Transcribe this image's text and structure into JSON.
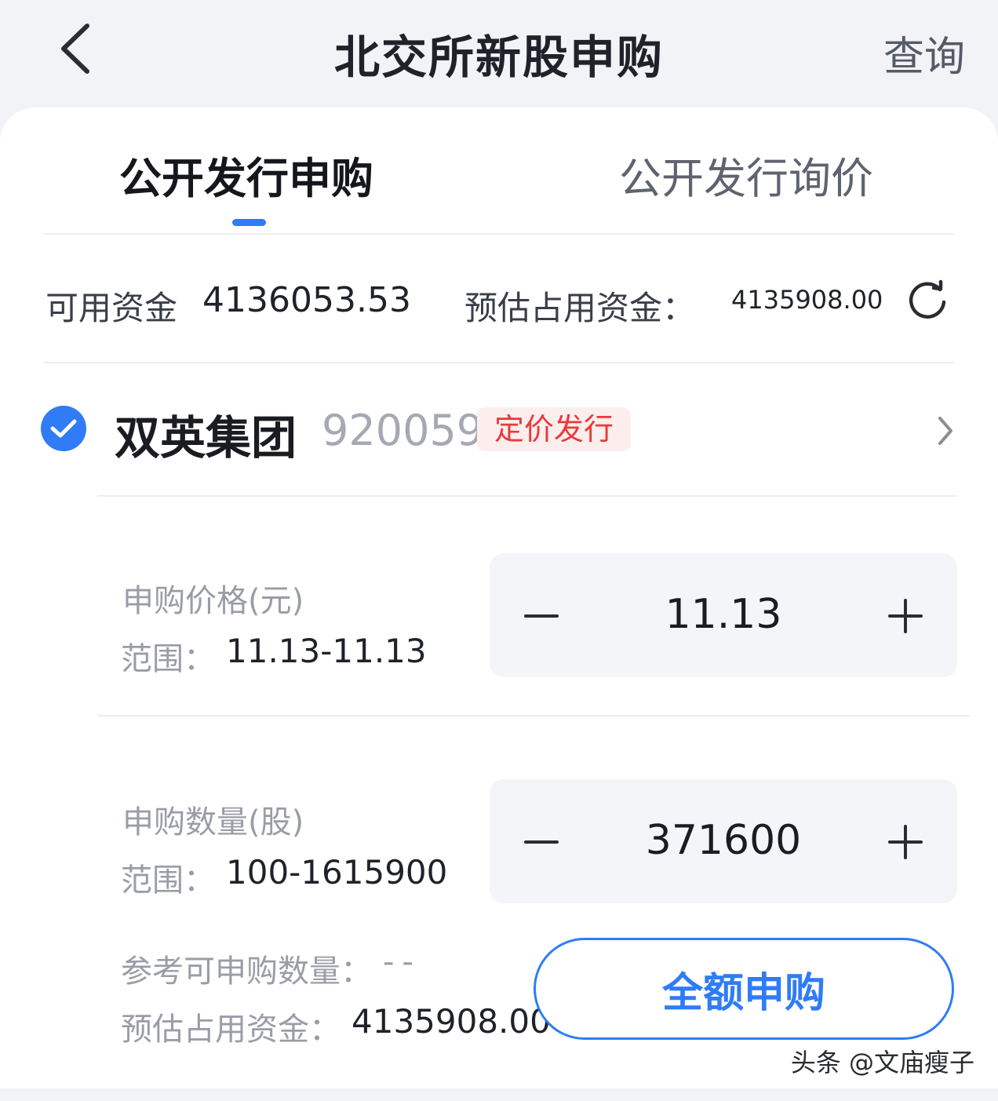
{
  "header": {
    "title": "北交所新股申购",
    "action_label": "查询"
  },
  "tabs": [
    {
      "label": "公开发行申购",
      "active": true
    },
    {
      "label": "公开发行询价",
      "active": false
    }
  ],
  "funds": {
    "available_label": "可用资金",
    "available_value": "4136053.53",
    "estimated_label": "预估占用资金：",
    "estimated_value": "4135908.00"
  },
  "stock": {
    "selected": true,
    "name": "双英集团",
    "code": "920059",
    "badge": "定价发行"
  },
  "price": {
    "label": "申购价格(元)",
    "range_label": "范围：",
    "range_value": "11.13-11.13",
    "value": "11.13"
  },
  "quantity": {
    "label": "申购数量(股)",
    "range_label": "范围：",
    "range_value": "100-1615900",
    "value": "371600"
  },
  "reference": {
    "label": "参考可申购数量：",
    "value": "--",
    "estimated_label": "预估占用资金：",
    "estimated_value": "4135908.00"
  },
  "full_button_label": "全额申购",
  "watermark": "头条 @文庙瘦子",
  "colors": {
    "accent": "#2f7cf6",
    "badge_text": "#e83a3a",
    "badge_bg": "#fdeeee"
  },
  "icons": {
    "back": "chevron-left-icon",
    "refresh": "refresh-icon",
    "check": "check-circle-icon",
    "next": "chevron-right-icon",
    "minus": "minus-icon",
    "plus": "plus-icon"
  }
}
